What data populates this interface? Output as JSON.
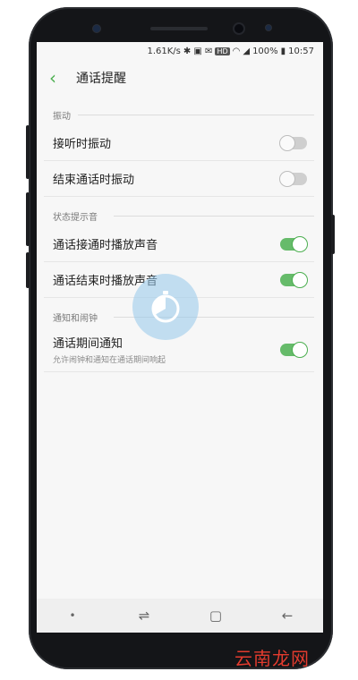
{
  "status_bar": {
    "speed": "1.61K/s",
    "icons": "✱ ▣ ✉",
    "hd": "HD",
    "battery": "100%",
    "time": "10:57"
  },
  "header": {
    "back_icon": "‹",
    "title": "通话提醒"
  },
  "sections": [
    {
      "title": "振动",
      "items": [
        {
          "label": "接听时振动",
          "toggle": false
        },
        {
          "label": "结束通话时振动",
          "toggle": false
        }
      ]
    },
    {
      "title": "状态提示音",
      "items": [
        {
          "label": "通话接通时播放声音",
          "toggle": true
        },
        {
          "label": "通话结束时播放声音",
          "toggle": true
        }
      ]
    },
    {
      "title": "通知和闹钟",
      "items": [
        {
          "label": "通话期间通知",
          "sublabel": "允许闹钟和通知在通话期间响起",
          "toggle": true
        }
      ]
    }
  ],
  "nav_bar": {
    "dot": "•",
    "recents": "⇌",
    "home": "▢",
    "back": "←"
  },
  "watermark": "云南龙网",
  "colors": {
    "accent": "#4caf50",
    "toggle_on": "#66bb6a",
    "toggle_off": "#cfcfcf",
    "touch_overlay": "#96c8eb",
    "watermark": "#e23b2e"
  }
}
